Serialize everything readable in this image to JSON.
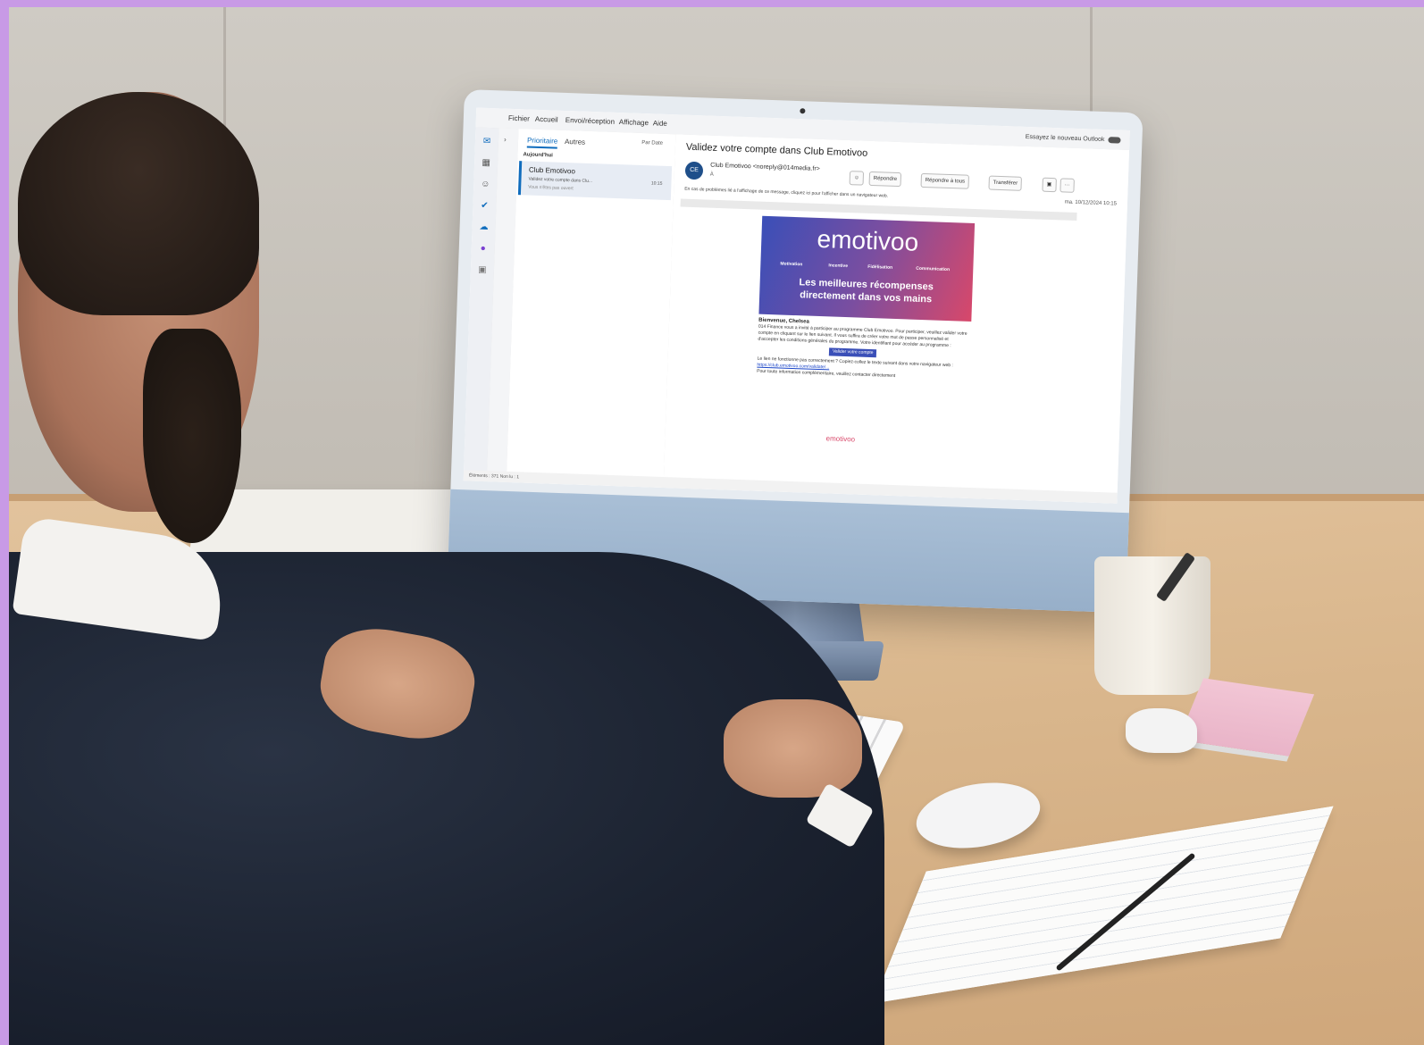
{
  "outlook": {
    "menu": [
      "Fichier",
      "Accueil",
      "Envoi/réception",
      "Affichage",
      "Aide"
    ],
    "try_new": "Essayez le nouveau Outlook",
    "tabs": [
      "Prioritaire",
      "Autres"
    ],
    "sort_label": "Par Date",
    "group_label": "Aujourd'hui",
    "list_item": {
      "sender": "Club Emotivoo",
      "subject": "Validez votre compte dans Clu...",
      "time": "10:15",
      "preview": "Vous n'êtes pas ouvert"
    },
    "message": {
      "subject": "Validez votre compte dans Club Emotivoo",
      "avatar_initials": "CE",
      "from": "Club Emotivoo <noreply@014media.fr>",
      "to": "À",
      "info": "En cas de problèmes lié à l'affichage de ce message, cliquez ici pour l'afficher dans un navigateur web.",
      "date": "ma. 10/12/2024 10:15",
      "actions": [
        "Répondre",
        "Répondre à tous",
        "Transférer"
      ],
      "banner": {
        "brand": "emotivoo",
        "pillars": [
          "Motivation",
          "Incentive",
          "Fidélisation",
          "Communication"
        ],
        "tagline_line1": "Les meilleures récompenses",
        "tagline_line2": "directement dans vos mains"
      },
      "greeting": "Bienvenue, Chelsea",
      "paragraph": "014 Finance vous a invité à participer au programme Club Emotivoo. Pour participer, veuillez valider votre compte en cliquant sur le lien suivant. Il vous suffira de créer votre mot de passe personnalisé et d'accepter les conditions générales du programme. Votre identifiant pour accéder au programme :",
      "cta": "Valider votre compte",
      "fallback_text": "Le lien ne fonctionne pas correctement ? Copiez-collez le texte suivant dans votre navigateur web :",
      "fallback_link": "https://club.emotivoo.com/validate/...",
      "contact_text": "Pour toute information complémentaire, veuillez contacter directement",
      "footer_brand": "emotivoo"
    },
    "status": "Éléments : 371    Non lu : 1"
  },
  "colors": {
    "frame": "#c89ae6",
    "accent": "#0f6cbd"
  }
}
